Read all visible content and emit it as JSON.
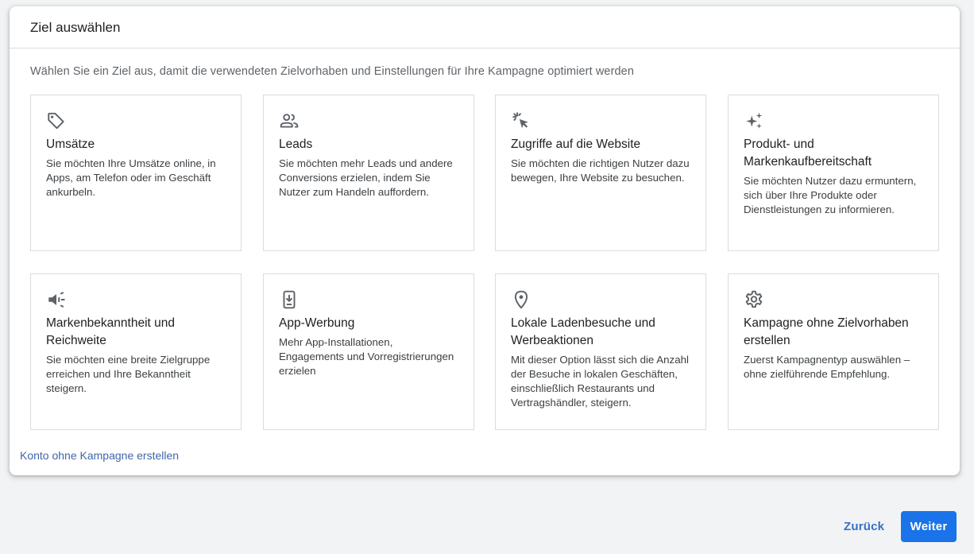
{
  "dialog": {
    "title": "Ziel auswählen",
    "intro": "Wählen Sie ein Ziel aus, damit die verwendeten Zielvorhaben und Einstellungen für Ihre Kampagne optimiert werden"
  },
  "goals": [
    {
      "icon": "tag-icon",
      "title": "Umsätze",
      "description": "Sie möchten Ihre Umsätze online, in Apps, am Telefon oder im Geschäft ankurbeln."
    },
    {
      "icon": "people-icon",
      "title": "Leads",
      "description": "Sie möchten mehr Leads und andere Conversions erzielen, indem Sie Nutzer zum Handeln auffordern."
    },
    {
      "icon": "cursor-click-icon",
      "title": "Zugriffe auf die Website",
      "description": "Sie möchten die richtigen Nutzer dazu bewegen, Ihre Website zu besuchen."
    },
    {
      "icon": "sparkle-icon",
      "title": "Produkt- und Markenkaufbereitschaft",
      "description": "Sie möchten Nutzer dazu ermuntern, sich über Ihre Produkte oder Dienstleistungen zu informieren."
    },
    {
      "icon": "megaphone-icon",
      "title": "Markenbekanntheit und Reichweite",
      "description": "Sie möchten eine breite Zielgruppe erreichen und Ihre Bekanntheit steigern."
    },
    {
      "icon": "mobile-download-icon",
      "title": "App-Werbung",
      "description": "Mehr App-Installationen, Engagements und Vorregistrierungen erzielen"
    },
    {
      "icon": "location-pin-icon",
      "title": "Lokale Ladenbesuche und Werbeaktionen",
      "description": "Mit dieser Option lässt sich die Anzahl der Besuche in lokalen Geschäften, einschließlich Restaurants und Vertragshändler, steigern."
    },
    {
      "icon": "gear-icon",
      "title": "Kampagne ohne Zielvorhaben erstellen",
      "description": "Zuerst Kampagnentyp auswählen – ohne zielführende Empfehlung."
    }
  ],
  "links": {
    "no_campaign": "Konto ohne Kampagne erstellen"
  },
  "footer": {
    "back_label": "Zurück",
    "next_label": "Weiter"
  },
  "colors": {
    "accent": "#1a73e8",
    "icon": "#5f6368",
    "border": "#dadce0"
  }
}
